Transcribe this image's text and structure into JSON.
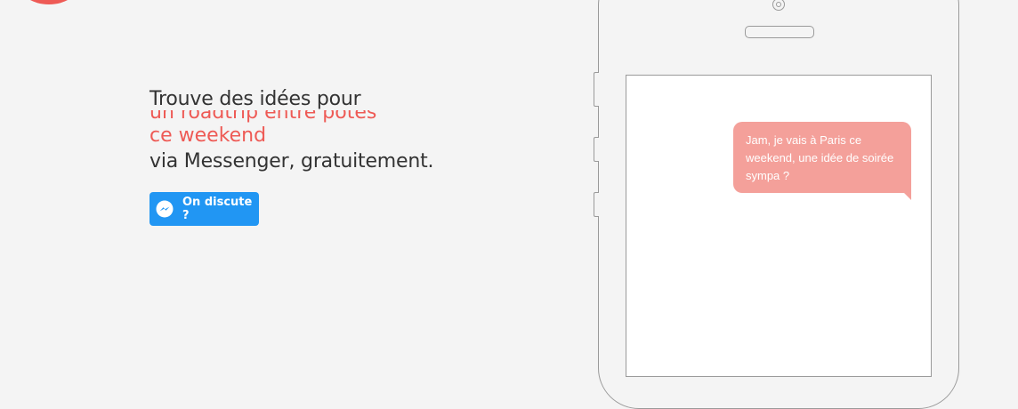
{
  "hero": {
    "headline": "Trouve des idées pour",
    "rotating_ghost": "un roadtrip entre potes",
    "rotating_current": "ce weekend",
    "tagline": "via Messenger, gratuitement."
  },
  "cta": {
    "label": "On discute ?",
    "icon": "messenger-icon",
    "color": "#2196f3"
  },
  "phone": {
    "message": "Jam, je vais à Paris ce weekend, une idée de soirée sympa ?",
    "bubble_color": "#f4a09a"
  },
  "colors": {
    "accent": "#ee5a55",
    "background": "#f4f4f4",
    "text": "#333333"
  }
}
